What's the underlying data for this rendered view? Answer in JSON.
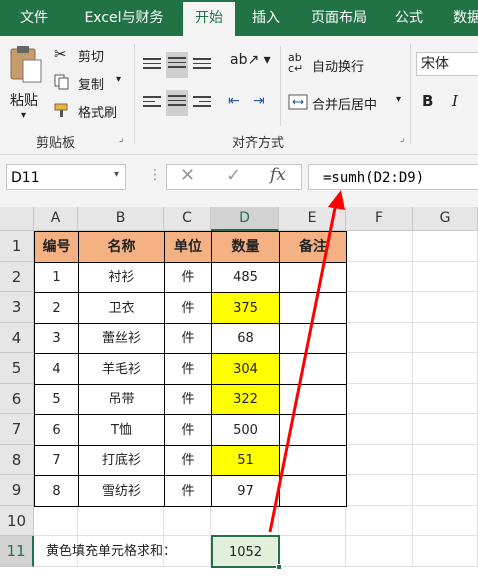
{
  "ribbon_tabs": [
    "文件",
    "Excel与财务",
    "开始",
    "插入",
    "页面布局",
    "公式",
    "数据"
  ],
  "active_tab": "开始",
  "clipboard": {
    "paste": "粘贴",
    "cut": "剪切",
    "copy": "复制",
    "format_painter": "格式刷",
    "group": "剪贴板"
  },
  "alignment": {
    "wrap_text": "自动换行",
    "merge_center": "合并后居中",
    "group": "对齐方式"
  },
  "font": {
    "name": "宋体",
    "bold": "B",
    "italic": "I"
  },
  "formula_bar": {
    "name_box": "D11",
    "cancel": "✕",
    "enter": "✓",
    "fx": "fx",
    "formula": "=sumh(D2:D9)"
  },
  "columns": [
    "A",
    "B",
    "C",
    "D",
    "E",
    "F",
    "G"
  ],
  "rows": [
    "1",
    "2",
    "3",
    "4",
    "5",
    "6",
    "7",
    "8",
    "9",
    "10",
    "11"
  ],
  "table": {
    "headers": [
      "编号",
      "名称",
      "单位",
      "数量",
      "备注"
    ],
    "rows": [
      {
        "no": "1",
        "name": "衬衫",
        "unit": "件",
        "qty": "485",
        "highlight": false
      },
      {
        "no": "2",
        "name": "卫衣",
        "unit": "件",
        "qty": "375",
        "highlight": true
      },
      {
        "no": "3",
        "name": "蕾丝衫",
        "unit": "件",
        "qty": "68",
        "highlight": false
      },
      {
        "no": "4",
        "name": "羊毛衫",
        "unit": "件",
        "qty": "304",
        "highlight": true
      },
      {
        "no": "5",
        "name": "吊带",
        "unit": "件",
        "qty": "322",
        "highlight": true
      },
      {
        "no": "6",
        "name": "T恤",
        "unit": "件",
        "qty": "500",
        "highlight": false
      },
      {
        "no": "7",
        "name": "打底衫",
        "unit": "件",
        "qty": "51",
        "highlight": true
      },
      {
        "no": "8",
        "name": "雪纺衫",
        "unit": "件",
        "qty": "97",
        "highlight": false
      }
    ]
  },
  "summary": {
    "label": "黄色填充单元格求和：",
    "value": "1052"
  },
  "colors": {
    "excel_green": "#217346",
    "header_fill": "#f4b183",
    "yellow": "#ffff00",
    "selected_cell": "#e2efda",
    "arrow": "#ff0000"
  }
}
